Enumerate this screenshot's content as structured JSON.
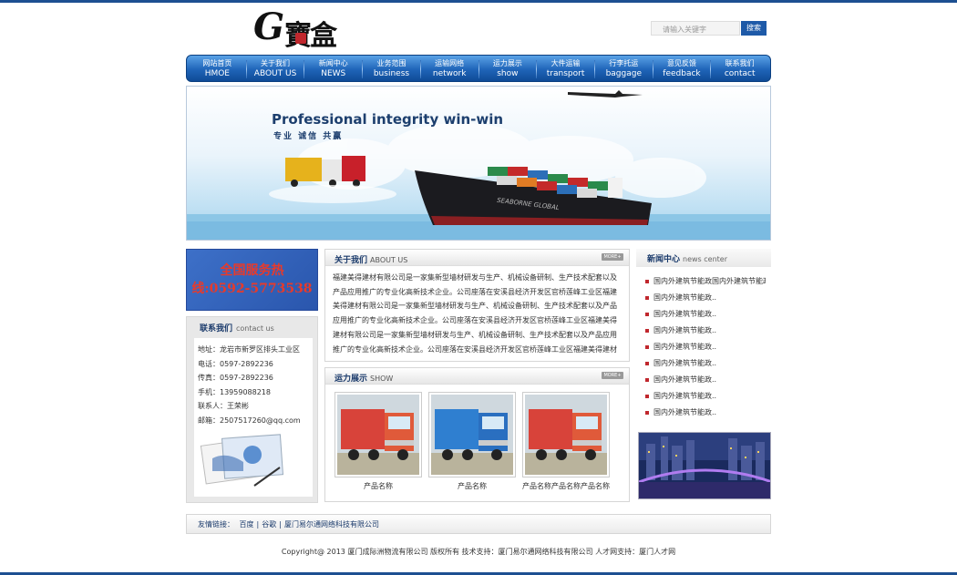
{
  "header": {
    "logo_text_g": "G",
    "logo_text_cn": "寶盒",
    "search_placeholder": "请输入关键字",
    "search_button": "搜索"
  },
  "nav": [
    {
      "cn": "网站首页",
      "en": "HMOE"
    },
    {
      "cn": "关于我们",
      "en": "ABOUT US"
    },
    {
      "cn": "新闻中心",
      "en": "NEWS"
    },
    {
      "cn": "业务范围",
      "en": "business"
    },
    {
      "cn": "运输网络",
      "en": "network"
    },
    {
      "cn": "运力展示",
      "en": "show"
    },
    {
      "cn": "大件运输",
      "en": "transport"
    },
    {
      "cn": "行李托运",
      "en": "baggage"
    },
    {
      "cn": "意见反馈",
      "en": "feedback"
    },
    {
      "cn": "联系我们",
      "en": "contact"
    }
  ],
  "banner": {
    "slogan": "Professional  integrity  win-win",
    "sub": "专业  诚信  共赢",
    "ship_name": "SEABORNE GLOBAL"
  },
  "hotline": {
    "line1": "全国服务热",
    "line2": "线:0592-5773538"
  },
  "contact": {
    "title": "联系我们",
    "title_en": "contact us",
    "address": "地址：龙岩市新罗区排头工业区",
    "phone": "电话：0597-2892236",
    "fax": "传真：0597-2892236",
    "mobile": "手机：13959088218",
    "person": "联系人：王荣彬",
    "email": "邮箱：2507517260@qq.com"
  },
  "about": {
    "title": "关于我们",
    "title_en": "ABOUT US",
    "more": "MORE+",
    "text": "福建美得建材有限公司是一家集新型墙材研发与生产、机械设备研制、生产技术配套以及产品应用推广的专业化高新技术企业。公司座落在安溪县经济开发区官桥莲峰工业区福建美得建材有限公司是一家集新型墙材研发与生产、机械设备研制、生产技术配套以及产品应用推广的专业化高新技术企业。公司座落在安溪县经济开发区官桥莲峰工业区福建美得建材有限公司是一家集新型墙材研发与生产、机械设备研制、生产技术配套以及产品应用推广的专业化高新技术企业。公司座落在安溪县经济开发区官桥莲峰工业区福建美得建材有限公司是一家集新型墙材研发"
  },
  "show": {
    "title": "运力展示",
    "title_en": "SHOW",
    "more": "MORE+",
    "products": [
      {
        "name": "产品名称",
        "color": "red"
      },
      {
        "name": "产品名称",
        "color": "blue"
      },
      {
        "name": "产品名称产品名称产品名称",
        "color": "red"
      }
    ]
  },
  "news": {
    "title": "新闻中心",
    "title_en": "news center",
    "items": [
      "国内外建筑节能政国内外建筑节能政",
      "国内外建筑节能政..",
      "国内外建筑节能政..",
      "国内外建筑节能政..",
      "国内外建筑节能政..",
      "国内外建筑节能政..",
      "国内外建筑节能政..",
      "国内外建筑节能政..",
      "国内外建筑节能政.."
    ]
  },
  "friends": {
    "label": "友情链接：",
    "links": [
      "百度",
      "谷歌",
      "厦门易尔通网络科技有限公司"
    ],
    "sep": "|"
  },
  "footer": {
    "text": "Copyright@ 2013 厦门成际洲物流有限公司 版权所有 技术支持：厦门易尔通网络科技有限公司 人才网支持：厦门人才网"
  },
  "colors": {
    "brand_blue": "#1d4f91",
    "nav_blue": "#1f64b8",
    "hotline_red": "#e83a2a"
  }
}
